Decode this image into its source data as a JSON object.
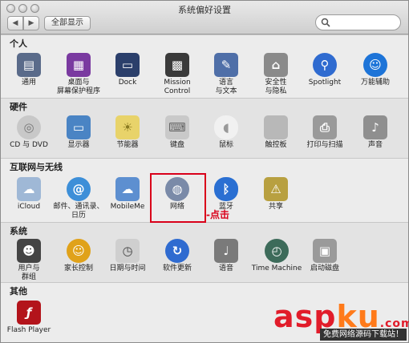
{
  "window": {
    "title": "系统偏好设置",
    "show_all": "全部显示"
  },
  "sections": {
    "personal": {
      "title": "个人",
      "items": [
        {
          "label": "通用",
          "icon": "general-icon",
          "color": "#5a6b8a"
        },
        {
          "label": "桌面与\n屏幕保护程序",
          "icon": "desktop-icon",
          "color": "#7a3aa0"
        },
        {
          "label": "Dock",
          "icon": "dock-icon",
          "color": "#2b3f6b"
        },
        {
          "label": "Mission\nControl",
          "icon": "mission-control-icon",
          "color": "#3a3a3a"
        },
        {
          "label": "语言\n与文本",
          "icon": "language-icon",
          "color": "#4f6fa8"
        },
        {
          "label": "安全性\n与隐私",
          "icon": "security-icon",
          "color": "#8a8a8a"
        },
        {
          "label": "Spotlight",
          "icon": "spotlight-icon",
          "color": "#2f6bd0"
        },
        {
          "label": "万能辅助",
          "icon": "accessibility-icon",
          "color": "#1d74d8"
        }
      ]
    },
    "hardware": {
      "title": "硬件",
      "items": [
        {
          "label": "CD 与 DVD",
          "icon": "cd-dvd-icon",
          "color": "#c8c8c8"
        },
        {
          "label": "显示器",
          "icon": "display-icon",
          "color": "#4a84c4"
        },
        {
          "label": "节能器",
          "icon": "energy-saver-icon",
          "color": "#e8d36a"
        },
        {
          "label": "键盘",
          "icon": "keyboard-icon",
          "color": "#c9c9c9"
        },
        {
          "label": "鼠标",
          "icon": "mouse-icon",
          "color": "#f1f1f1"
        },
        {
          "label": "触控板",
          "icon": "trackpad-icon",
          "color": "#b8b8b8"
        },
        {
          "label": "打印与扫描",
          "icon": "printer-icon",
          "color": "#9a9a9a"
        },
        {
          "label": "声音",
          "icon": "sound-icon",
          "color": "#8f8f8f"
        }
      ]
    },
    "internet": {
      "title": "互联网与无线",
      "items": [
        {
          "label": "iCloud",
          "icon": "icloud-icon",
          "color": "#9fb8d6"
        },
        {
          "label": "邮件、通讯录、\n日历",
          "icon": "mail-contacts-icon",
          "color": "#3d8fd8"
        },
        {
          "label": "MobileMe",
          "icon": "mobileme-icon",
          "color": "#5d8fd0"
        },
        {
          "label": "网络",
          "icon": "network-icon",
          "color": "#7a8aa8"
        },
        {
          "label": "蓝牙",
          "icon": "bluetooth-icon",
          "color": "#2a6fd2"
        },
        {
          "label": "共享",
          "icon": "sharing-icon",
          "color": "#b8a040"
        }
      ]
    },
    "system": {
      "title": "系统",
      "items": [
        {
          "label": "用户与\n群组",
          "icon": "users-icon",
          "color": "#444444"
        },
        {
          "label": "家长控制",
          "icon": "parental-controls-icon",
          "color": "#e0a21a"
        },
        {
          "label": "日期与时间",
          "icon": "date-time-icon",
          "color": "#cfcfcf"
        },
        {
          "label": "软件更新",
          "icon": "software-update-icon",
          "color": "#2f6bd0"
        },
        {
          "label": "语音",
          "icon": "speech-icon",
          "color": "#7a7a7a"
        },
        {
          "label": "Time Machine",
          "icon": "time-machine-icon",
          "color": "#3d6b5a"
        },
        {
          "label": "启动磁盘",
          "icon": "startup-disk-icon",
          "color": "#9a9a9a"
        }
      ]
    },
    "other": {
      "title": "其他",
      "items": [
        {
          "label": "Flash Player",
          "icon": "flash-player-icon",
          "color": "#b3141b"
        }
      ]
    }
  },
  "annotation": "-点击",
  "watermark": {
    "main_a": "asp",
    "main_b": "ku",
    "main_c": ".com",
    "sub": "免费网络源码下载站！"
  }
}
